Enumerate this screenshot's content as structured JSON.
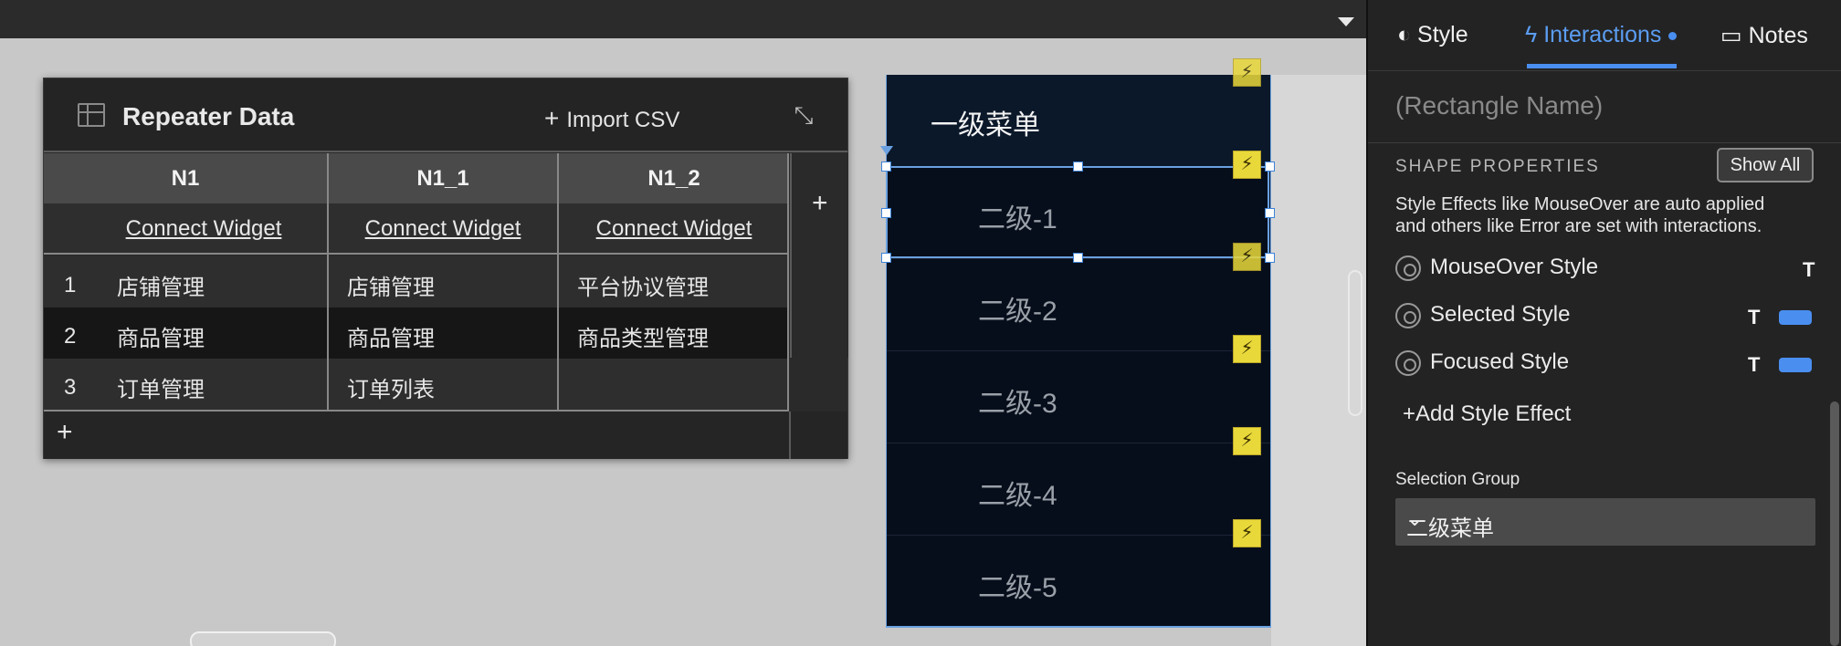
{
  "repeater": {
    "title": "Repeater Data",
    "import_label": "Import CSV",
    "columns": [
      "N1",
      "N1_1",
      "N1_2"
    ],
    "connect_label": "Connect Widget",
    "rows": [
      {
        "index": "1",
        "cells": [
          "店铺管理",
          "店铺管理",
          "平台协议管理"
        ]
      },
      {
        "index": "2",
        "cells": [
          "商品管理",
          "商品管理",
          "商品类型管理"
        ]
      },
      {
        "index": "3",
        "cells": [
          "订单管理",
          "订单列表",
          ""
        ]
      }
    ],
    "add_symbol": "+"
  },
  "menu": {
    "title": "一级菜单",
    "items": [
      "二级-1",
      "二级-2",
      "二级-3",
      "二级-4",
      "二级-5"
    ],
    "bolt_glyph": "⚡"
  },
  "inspector": {
    "tabs": [
      "Style",
      "Interactions",
      "Notes"
    ],
    "active_tab": "Interactions",
    "name_placeholder": "(Rectangle Name)",
    "section_title": "SHAPE PROPERTIES",
    "show_all": "Show All",
    "hint": "Style Effects like MouseOver are auto applied and others like Error are set with interactions.",
    "effects": [
      {
        "label": "MouseOver Style",
        "t": "T",
        "swatch": false
      },
      {
        "label": "Selected Style",
        "t": "T",
        "swatch": true
      },
      {
        "label": "Focused Style",
        "t": "T",
        "swatch": true
      }
    ],
    "add_effect": "Add Style Effect",
    "selection_group_label": "Selection Group",
    "selection_group_value": "二级菜单",
    "accent": "#4a8ef0"
  }
}
